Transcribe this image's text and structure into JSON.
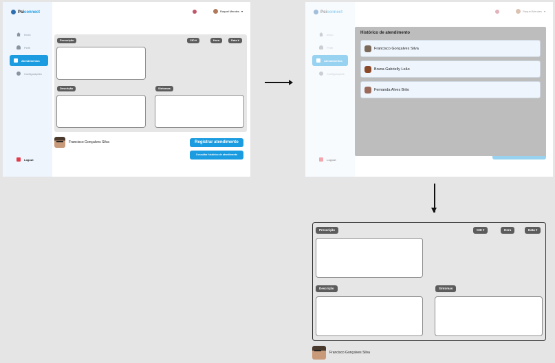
{
  "app": {
    "brand_prefix": "Psi",
    "brand_suffix": "connect"
  },
  "user": {
    "name": "Raquel Mendes"
  },
  "nav": {
    "home": "Início",
    "profile": "Perfil",
    "appointments": "Atendimentos",
    "settings": "Configurações",
    "logout": "Logout"
  },
  "form": {
    "prescription": "Prescrição",
    "cid": "CID ▾",
    "hour": "Hora",
    "date": "Data ▾",
    "description": "Descrição",
    "symptoms": "Sintomas"
  },
  "patient": {
    "name": "Francisco Gonçalves Silva"
  },
  "actions": {
    "register": "Registrar atendimento",
    "history": "Consultar histórico de atendimento"
  },
  "history_modal": {
    "title": "Histórico de atendimento",
    "patients": [
      {
        "name": "Francisco Gonçalves Silva"
      },
      {
        "name": "Bruna Gabrielly Leão"
      },
      {
        "name": "Fernanda Alves Brito"
      }
    ]
  },
  "colors": {
    "accent": "#1b9be0",
    "sidebar": "#eef5fd",
    "panel": "#e6e6e6",
    "tag": "#5c5c5c"
  }
}
